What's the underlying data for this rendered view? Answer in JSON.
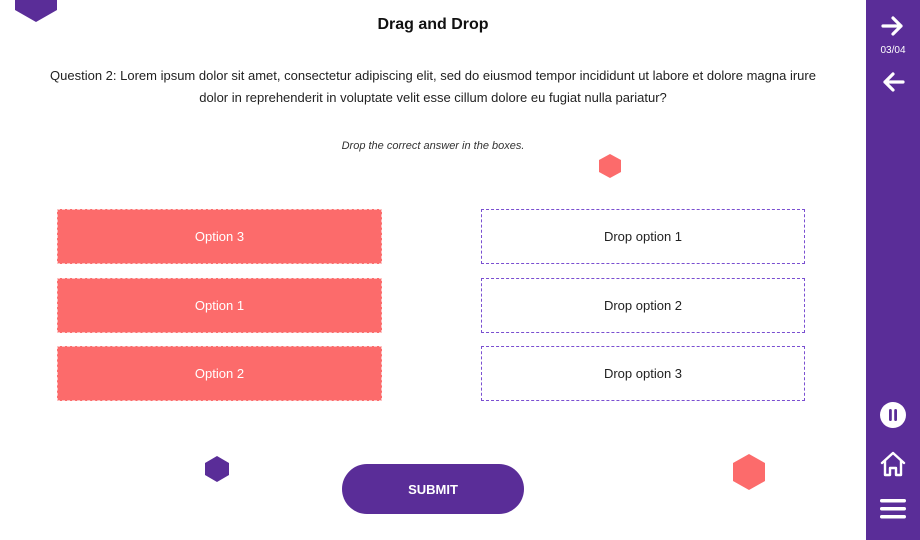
{
  "title": "Drag and Drop",
  "question": "Question 2: Lorem ipsum dolor sit amet, consectetur adipiscing elit, sed do eiusmod tempor incididunt ut labore et dolore magna irure dolor in reprehenderit in voluptate velit esse cillum dolore eu fugiat nulla pariatur?",
  "instruction": "Drop the correct answer in the boxes.",
  "options": [
    "Option 3",
    "Option 1",
    "Option 2"
  ],
  "drop_zones": [
    "Drop option 1",
    "Drop option 2",
    "Drop option 3"
  ],
  "submit_label": "SUBMIT",
  "sidebar": {
    "counter": "03/04",
    "icons": [
      "arrow-right-icon",
      "arrow-left-icon",
      "pause-icon",
      "home-icon",
      "menu-icon"
    ]
  },
  "colors": {
    "accent": "#5a2d98",
    "option": "#fc6b6b",
    "drop_border": "#7a4fd1"
  }
}
